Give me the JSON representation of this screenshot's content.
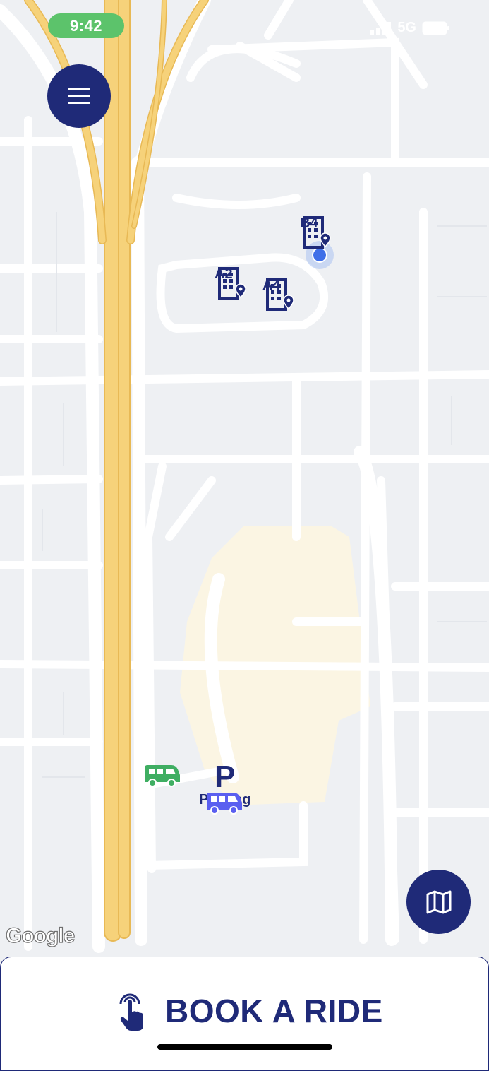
{
  "status_bar": {
    "time": "9:42",
    "network": "5G"
  },
  "map": {
    "attribution": "Google",
    "markers": [
      {
        "label": "B4",
        "icon": "building-pin-icon"
      },
      {
        "label": "A2",
        "icon": "building-pin-icon"
      },
      {
        "label": "A4",
        "icon": "building-pin-icon"
      },
      {
        "label": "Parking",
        "icon": "parking-icon"
      }
    ],
    "vehicles": [
      {
        "icon": "van-icon",
        "color": "#3fae62"
      },
      {
        "icon": "van-icon",
        "color": "#5a5ff0"
      }
    ]
  },
  "controls": {
    "menu_icon": "hamburger-menu-icon",
    "map_icon": "map-icon"
  },
  "book_ride": {
    "label": "BOOK A RIDE",
    "icon": "tap-hand-icon"
  },
  "colors": {
    "brand": "#1f2a78",
    "highway": "#f6d27a",
    "map_bg": "#eef0f3",
    "road": "#ffffff",
    "status_time_bg": "#5cc36b"
  }
}
